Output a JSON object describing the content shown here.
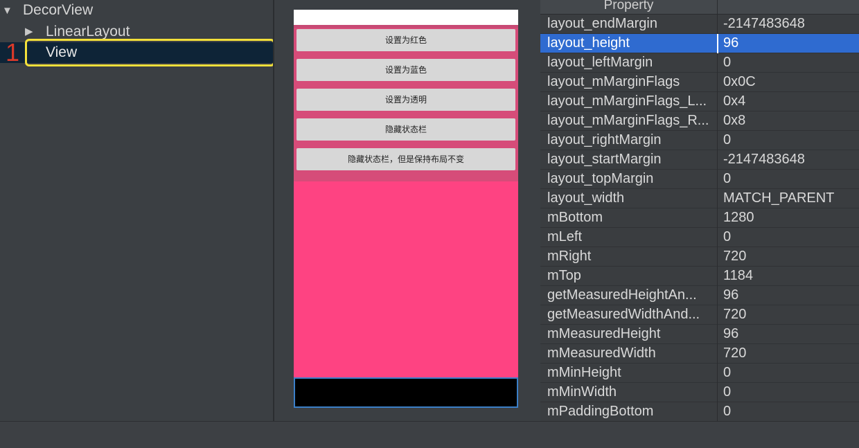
{
  "tree": {
    "items": [
      {
        "label": "DecorView",
        "expanded": true,
        "arrow": "triangle-down"
      },
      {
        "label": "LinearLayout",
        "expanded": false,
        "arrow": "triangle-right"
      },
      {
        "label": "View",
        "selected": true
      }
    ],
    "annotation_number": "1",
    "highlight_color": "#f2e03a"
  },
  "preview": {
    "buttons": [
      "设置为红色",
      "设置为蓝色",
      "设置为透明",
      "隐藏状态栏",
      "隐藏状态栏，但是保持布局不变"
    ],
    "background_color": "#fe4382",
    "navbar_color": "#000000"
  },
  "properties": {
    "header": "Property",
    "selected_index": 1,
    "rows": [
      {
        "name": "layout_endMargin",
        "value": "-2147483648"
      },
      {
        "name": "layout_height",
        "value": "96"
      },
      {
        "name": "layout_leftMargin",
        "value": "0"
      },
      {
        "name": "layout_mMarginFlags",
        "value": "0x0C"
      },
      {
        "name": "layout_mMarginFlags_L...",
        "value": "0x4"
      },
      {
        "name": "layout_mMarginFlags_R...",
        "value": "0x8"
      },
      {
        "name": "layout_rightMargin",
        "value": "0"
      },
      {
        "name": "layout_startMargin",
        "value": "-2147483648"
      },
      {
        "name": "layout_topMargin",
        "value": "0"
      },
      {
        "name": "layout_width",
        "value": "MATCH_PARENT"
      },
      {
        "name": "mBottom",
        "value": "1280"
      },
      {
        "name": "mLeft",
        "value": "0"
      },
      {
        "name": "mRight",
        "value": "720"
      },
      {
        "name": "mTop",
        "value": "1184"
      },
      {
        "name": "getMeasuredHeightAn...",
        "value": "96"
      },
      {
        "name": "getMeasuredWidthAnd...",
        "value": "720"
      },
      {
        "name": "mMeasuredHeight",
        "value": "96"
      },
      {
        "name": "mMeasuredWidth",
        "value": "720"
      },
      {
        "name": "mMinHeight",
        "value": "0"
      },
      {
        "name": "mMinWidth",
        "value": "0"
      },
      {
        "name": "mPaddingBottom",
        "value": "0"
      }
    ]
  }
}
